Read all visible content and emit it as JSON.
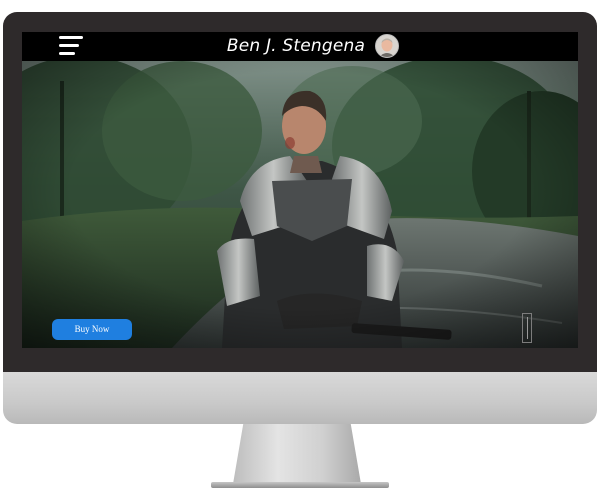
{
  "header": {
    "title": "Ben J. Stengena",
    "menu_icon": "hamburger-menu-icon",
    "avatar_icon": "profile-avatar"
  },
  "hero": {
    "image": "knight-in-armor-rain-forest-photo",
    "button_label": "Buy Now",
    "button_color": "#1f7fe0"
  },
  "colors": {
    "bezel": "#2e2a2b",
    "topbar": "#000000",
    "chin": "#cccccc"
  }
}
